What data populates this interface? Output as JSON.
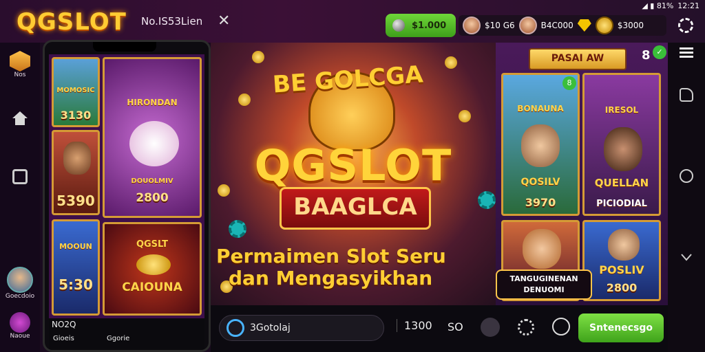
{
  "header": {
    "logo": "QGSLOT",
    "title": "No.IS53Lien",
    "balance": "$1.000",
    "stats": {
      "val1": "$10 G6",
      "val2": "B4C000",
      "val3": "$3000"
    },
    "status_time": "12:21",
    "status_signal": "◢ ▮ 81%"
  },
  "left_rail": {
    "top_label": "Nos",
    "bottom_label1": "Goecdoio",
    "bottom_label2": "Naoue"
  },
  "phone": {
    "tiles": [
      {
        "label": "MOMOSIC",
        "num": "3130"
      },
      {
        "label": "HIRONDAN",
        "num": ""
      },
      {
        "label": "",
        "num": "5390"
      },
      {
        "label": "",
        "num": "2800"
      },
      {
        "label": "MOOUN",
        "num": "5:30"
      },
      {
        "label": "CAIOUNA",
        "num": ""
      }
    ],
    "tile_sub_label": "DOUOLMIV",
    "qgslot_label": "QGSLT",
    "footer_title": "NO2Q",
    "footer_left": "Gioeis",
    "footer_right": "Ggorie"
  },
  "banner": {
    "top": "BE GOLCGA",
    "logo": "QGSLOT",
    "ribbon": "BAAGLCA",
    "sub1": "Permaimen Slot Seru",
    "sub2": "dan Mengasyikhan"
  },
  "right_panel": {
    "header": "PASAI AW",
    "count": "8",
    "badge": "8",
    "tiles": [
      {
        "label": "BONAUNA",
        "name": "QOSILV",
        "num": "3970"
      },
      {
        "label": "IRESOL",
        "name": "QUELLAN",
        "num": "PICIODIAL"
      },
      {
        "label": "",
        "name": "",
        "num": ""
      },
      {
        "label": "",
        "name": "POSLIV",
        "num": "2800"
      }
    ],
    "promo_line1": "TANGUGINENAN",
    "promo_line2": "DENUOMI"
  },
  "bottom_bar": {
    "search_text": "3Gotolaj",
    "bet_value": "1300",
    "bet_lines": "SO",
    "start_label": "Sntenecsgo"
  },
  "colors": {
    "gold": "#ffcc33",
    "green_button": "#4fb528",
    "purple_bg": "#3e0f4a"
  }
}
